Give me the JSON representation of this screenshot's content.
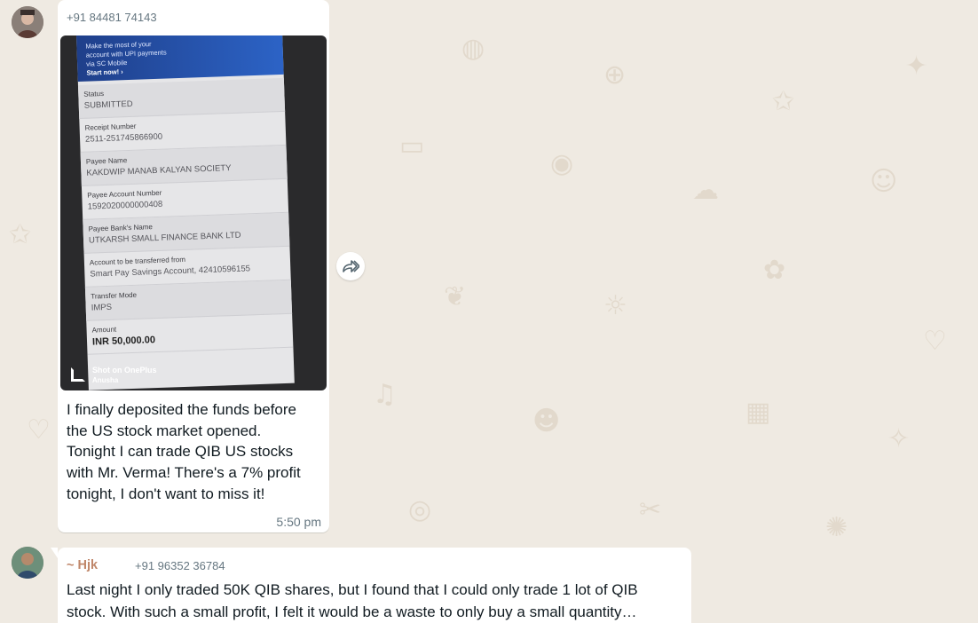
{
  "colors": {
    "background": "#efeae2",
    "bubble": "#ffffff",
    "sender_name": "#c0876a",
    "meta_text": "#667781",
    "text": "#111b21"
  },
  "messages": [
    {
      "avatar_icon": "user-avatar-icon",
      "phone": "+91 84481 74143",
      "image": {
        "banner_line": "Make the most of your account with UPI payments via SC Mobile",
        "banner_cta": "Start now! ›",
        "fields": [
          {
            "label": "Status",
            "value": "SUBMITTED"
          },
          {
            "label": "Receipt Number",
            "value": "2511-251745866900"
          },
          {
            "label": "Payee Name",
            "value": "KAKDWIP MANAB KALYAN SOCIETY"
          },
          {
            "label": "Payee Account Number",
            "value": "1592020000000408"
          },
          {
            "label": "Payee Bank's Name",
            "value": "UTKARSH SMALL FINANCE BANK LTD"
          },
          {
            "label": "Account to be transferred from",
            "value": "Smart Pay Savings Account, 42410596155"
          },
          {
            "label": "Transfer Mode",
            "value": "IMPS"
          },
          {
            "label": "Amount",
            "value": "INR 50,000.00"
          }
        ],
        "watermark_line1": "Shot on OnePlus",
        "watermark_line2": "Anusha"
      },
      "text": "I finally deposited the funds before\nthe US stock market opened.\nTonight I can trade QIB US stocks\nwith Mr. Verma! There's a 7% profit\ntonight, I don't want to miss it!",
      "time": "5:50 pm",
      "forward_icon": "forward-icon"
    },
    {
      "avatar_icon": "user-avatar-icon",
      "name": "~ Hjk",
      "phone": "+91 96352 36784",
      "text": "Last night I only traded 50K QIB shares, but I found that I could only trade 1 lot of QIB\nstock. With such a small profit, I felt it would be a waste to only buy a small quantity…"
    }
  ]
}
